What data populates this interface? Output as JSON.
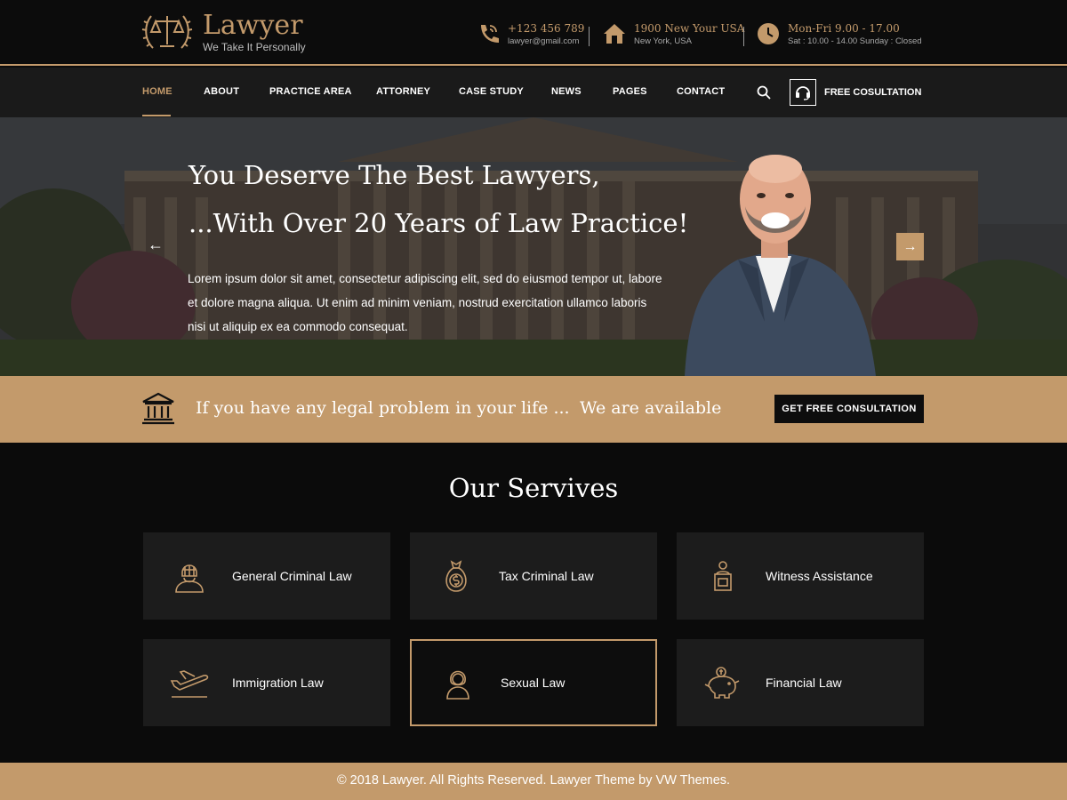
{
  "brand": {
    "title": "Lawyer",
    "tagline": "We Take It Personally",
    "accent": "#c39a6b"
  },
  "contacts": [
    {
      "icon": "phone-icon",
      "main": "+123 456 789",
      "sub": "lawyer@gmail.com"
    },
    {
      "icon": "home-icon",
      "main": "1900 New Your USA",
      "sub": "New York, USA"
    },
    {
      "icon": "clock-icon",
      "main": "Mon-Fri 9.00 - 17.00",
      "sub": "Sat : 10.00 - 14.00 Sunday : Closed"
    }
  ],
  "nav": {
    "items": [
      "HOME",
      "ABOUT",
      "PRACTICE AREA",
      "ATTORNEY",
      "CASE STUDY",
      "NEWS",
      "PAGES",
      "CONTACT"
    ],
    "active": "HOME",
    "consult_label": "FREE COSULTATION"
  },
  "hero": {
    "title_line1": "You Deserve The Best Lawyers,",
    "title_line2": "...With Over 20 Years of Law Practice!",
    "text": "Lorem ipsum dolor sit amet, consectetur adipiscing elit, sed do eiusmod tempor ut, labore et dolore magna aliqua. Ut enim ad minim veniam, nostrud exercitation ullamco laboris nisi ut aliquip ex ea commodo consequat.",
    "prev": "←",
    "next": "→"
  },
  "banner": {
    "text": "If you have any legal problem in your life ...",
    "text2": "We are available",
    "button": "GET FREE CONSULTATION"
  },
  "services": {
    "title": "Our Servives",
    "items": [
      {
        "label": "General Criminal Law",
        "icon": "criminal-icon"
      },
      {
        "label": "Tax Criminal Law",
        "icon": "money-bag-icon"
      },
      {
        "label": "Witness Assistance",
        "icon": "witness-icon"
      },
      {
        "label": "Immigration Law",
        "icon": "airplane-icon"
      },
      {
        "label": "Sexual Law",
        "icon": "woman-icon"
      },
      {
        "label": "Financial Law",
        "icon": "piggy-bank-icon"
      }
    ]
  },
  "footer": {
    "text": "© 2018 Lawyer. All Rights Reserved. Lawyer Theme by VW Themes."
  }
}
